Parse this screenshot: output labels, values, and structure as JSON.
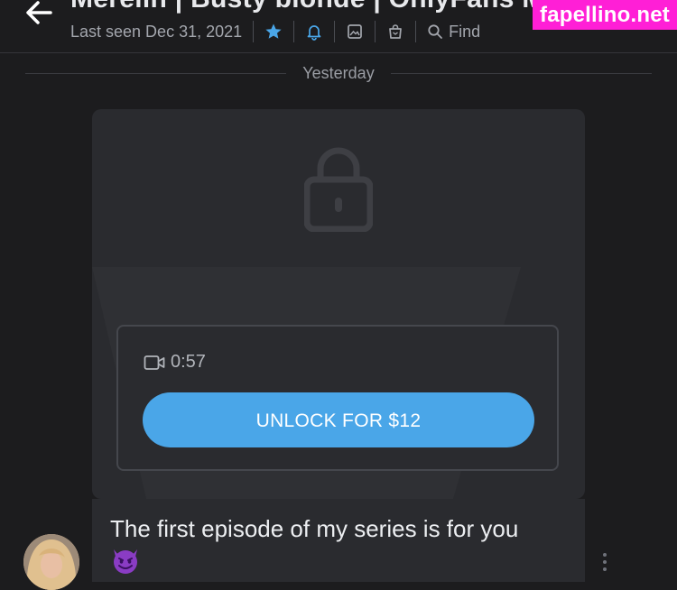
{
  "header": {
    "title": "Merelin | Busty blonde | OnlyFans M",
    "last_seen": "Last seen Dec 31, 2021",
    "find_label": "Find",
    "icons": [
      "back-arrow-icon",
      "star-icon",
      "bell-icon",
      "image-icon",
      "bag-icon",
      "search-icon"
    ],
    "accent_color": "#4aa6e8"
  },
  "watermark": "fapellino.net",
  "divider": {
    "label": "Yesterday"
  },
  "locked_media": {
    "duration": "0:57",
    "unlock_label": "UNLOCK FOR $12",
    "icons": [
      "lock-icon",
      "video-camera-icon"
    ]
  },
  "message": {
    "text": "The first episode of my series is for you",
    "emoji": "smiling-devil-emoji"
  }
}
